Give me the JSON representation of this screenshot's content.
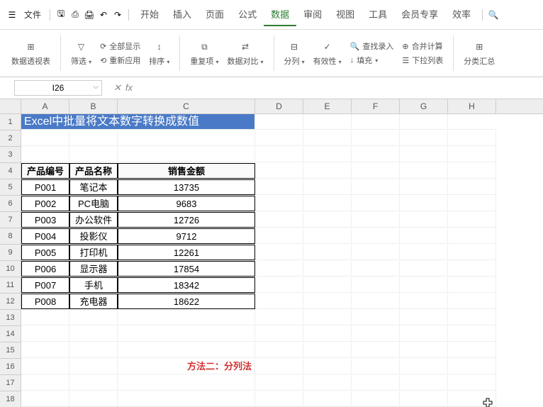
{
  "menubar": {
    "file_label": "文件",
    "tabs": [
      "开始",
      "插入",
      "页面",
      "公式",
      "数据",
      "审阅",
      "视图",
      "工具",
      "会员专享",
      "效率"
    ],
    "active_tab_index": 4
  },
  "ribbon": {
    "pivot_table": "数据透视表",
    "filter": "筛选",
    "show_all": "全部显示",
    "reapply": "重新应用",
    "sort": "排序",
    "duplicates": "重复项",
    "data_compare": "数据对比",
    "split_columns": "分列",
    "validation": "有效性",
    "find_record": "查找录入",
    "fill": "填充",
    "consolidate": "合并计算",
    "dropdown_list": "下拉列表",
    "subtotal": "分类汇总"
  },
  "formula_bar": {
    "name_box": "I26",
    "fx_label": "fx",
    "formula_value": ""
  },
  "columns": [
    "A",
    "B",
    "C",
    "D",
    "E",
    "F",
    "G",
    "H"
  ],
  "title_text": "Excel中批量将文本数字转换成数值",
  "table_headers": [
    "产品编号",
    "产品名称",
    "销售金额"
  ],
  "table_rows": [
    {
      "id": "P001",
      "name": "笔记本",
      "amount": "13735"
    },
    {
      "id": "P002",
      "name": "PC电脑",
      "amount": "9683"
    },
    {
      "id": "P003",
      "name": "办公软件",
      "amount": "12726"
    },
    {
      "id": "P004",
      "name": "投影仪",
      "amount": "9712"
    },
    {
      "id": "P005",
      "name": "打印机",
      "amount": "12261"
    },
    {
      "id": "P006",
      "name": "显示器",
      "amount": "17854"
    },
    {
      "id": "P007",
      "name": "手机",
      "amount": "18342"
    },
    {
      "id": "P008",
      "name": "充电器",
      "amount": "18622"
    }
  ],
  "method_text": "方法二：分列法"
}
